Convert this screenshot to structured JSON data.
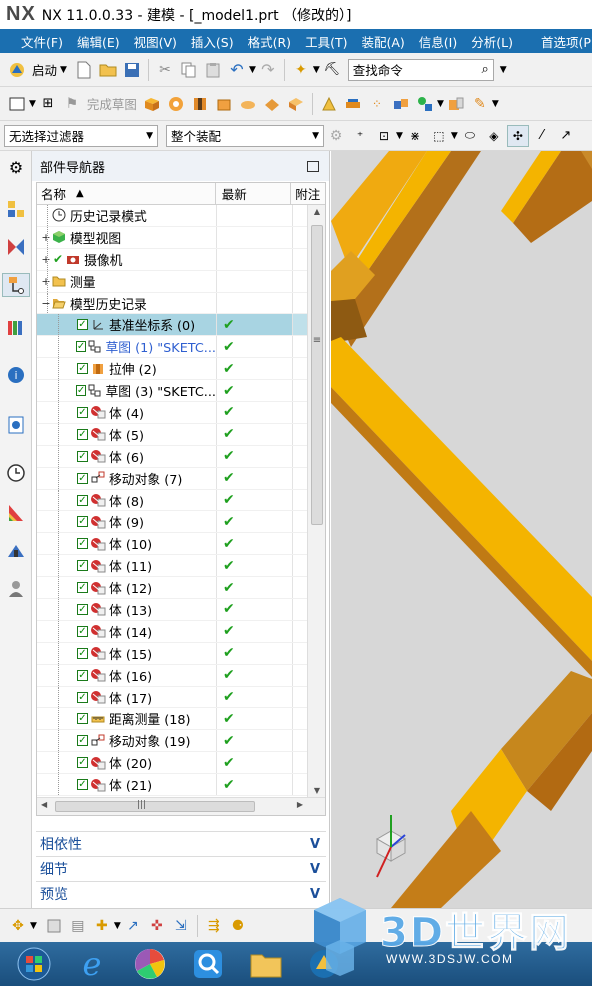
{
  "window": {
    "logo": "NX",
    "title": "NX 11.0.0.33 - 建模 - [_model1.prt （修改的）]"
  },
  "menu": {
    "items": [
      "文件(F)",
      "编辑(E)",
      "视图(V)",
      "插入(S)",
      "格式(R)",
      "工具(T)",
      "装配(A)",
      "信息(I)",
      "分析(L)"
    ],
    "preferences": "首选项(P)"
  },
  "toolbar": {
    "start_label": "启动",
    "search_placeholder": "查找命令",
    "sketch_label": "完成草图",
    "filter_value": "无选择过滤器",
    "assembly_value": "整个装配"
  },
  "navigator": {
    "title": "部件导航器",
    "columns": {
      "name": "名称",
      "latest": "最新",
      "attached": "附注"
    },
    "rows": [
      {
        "label": "历史记录模式",
        "icon": "clock-icon",
        "level": 0,
        "expander": "",
        "checkbox": false,
        "check": ""
      },
      {
        "label": "模型视图",
        "icon": "model-views-icon",
        "level": 0,
        "expander": "+",
        "checkbox": false,
        "check": ""
      },
      {
        "label": "摄像机",
        "icon": "camera-icon",
        "level": 0,
        "expander": "+",
        "checkbox": false,
        "check": "✔"
      },
      {
        "label": "测量",
        "icon": "folder-icon",
        "level": 0,
        "expander": "+",
        "checkbox": false,
        "check": ""
      },
      {
        "label": "模型历史记录",
        "icon": "folder-open-icon",
        "level": 0,
        "expander": "−",
        "checkbox": false,
        "check": ""
      },
      {
        "label": "基准坐标系 (0)",
        "icon": "datum-csys-icon",
        "level": 1,
        "expander": "",
        "checkbox": true,
        "check": "✔",
        "selected": true
      },
      {
        "label": "草图 (1) \"SKETC...",
        "icon": "sketch-icon",
        "level": 1,
        "expander": "",
        "checkbox": true,
        "check": "✔",
        "blue": true
      },
      {
        "label": "拉伸 (2)",
        "icon": "extrude-icon",
        "level": 1,
        "expander": "",
        "checkbox": true,
        "check": "✔"
      },
      {
        "label": "草图 (3) \"SKETC...",
        "icon": "sketch-icon",
        "level": 1,
        "expander": "",
        "checkbox": true,
        "check": "✔"
      },
      {
        "label": "体 (4)",
        "icon": "body-icon",
        "level": 1,
        "expander": "",
        "checkbox": true,
        "check": "✔"
      },
      {
        "label": "体 (5)",
        "icon": "body-icon",
        "level": 1,
        "expander": "",
        "checkbox": true,
        "check": "✔"
      },
      {
        "label": "体 (6)",
        "icon": "body-icon",
        "level": 1,
        "expander": "",
        "checkbox": true,
        "check": "✔"
      },
      {
        "label": "移动对象 (7)",
        "icon": "move-object-icon",
        "level": 1,
        "expander": "",
        "checkbox": true,
        "check": "✔"
      },
      {
        "label": "体 (8)",
        "icon": "body-icon",
        "level": 1,
        "expander": "",
        "checkbox": true,
        "check": "✔"
      },
      {
        "label": "体 (9)",
        "icon": "body-icon",
        "level": 1,
        "expander": "",
        "checkbox": true,
        "check": "✔"
      },
      {
        "label": "体 (10)",
        "icon": "body-icon",
        "level": 1,
        "expander": "",
        "checkbox": true,
        "check": "✔"
      },
      {
        "label": "体 (11)",
        "icon": "body-icon",
        "level": 1,
        "expander": "",
        "checkbox": true,
        "check": "✔"
      },
      {
        "label": "体 (12)",
        "icon": "body-icon",
        "level": 1,
        "expander": "",
        "checkbox": true,
        "check": "✔"
      },
      {
        "label": "体 (13)",
        "icon": "body-icon",
        "level": 1,
        "expander": "",
        "checkbox": true,
        "check": "✔"
      },
      {
        "label": "体 (14)",
        "icon": "body-icon",
        "level": 1,
        "expander": "",
        "checkbox": true,
        "check": "✔"
      },
      {
        "label": "体 (15)",
        "icon": "body-icon",
        "level": 1,
        "expander": "",
        "checkbox": true,
        "check": "✔"
      },
      {
        "label": "体 (16)",
        "icon": "body-icon",
        "level": 1,
        "expander": "",
        "checkbox": true,
        "check": "✔"
      },
      {
        "label": "体 (17)",
        "icon": "body-icon",
        "level": 1,
        "expander": "",
        "checkbox": true,
        "check": "✔"
      },
      {
        "label": "距离测量 (18)",
        "icon": "measure-distance-icon",
        "level": 1,
        "expander": "",
        "checkbox": true,
        "check": "✔"
      },
      {
        "label": "移动对象 (19)",
        "icon": "move-object-icon",
        "level": 1,
        "expander": "",
        "checkbox": true,
        "check": "✔"
      },
      {
        "label": "体 (20)",
        "icon": "body-icon",
        "level": 1,
        "expander": "",
        "checkbox": true,
        "check": "✔"
      },
      {
        "label": "体 (21)",
        "icon": "body-icon",
        "level": 1,
        "expander": "",
        "checkbox": true,
        "check": "✔"
      }
    ],
    "panels": [
      "相依性",
      "细节",
      "预览"
    ]
  },
  "watermark": {
    "brand": "3D世界网",
    "url": "WWW.3DSJW.COM"
  },
  "colors": {
    "menubar": "#1b6fb0",
    "beam": "#f4b400",
    "beam_dark": "#b36b12",
    "viewport": "#d6d6d6",
    "check_green": "#1fa01f"
  }
}
